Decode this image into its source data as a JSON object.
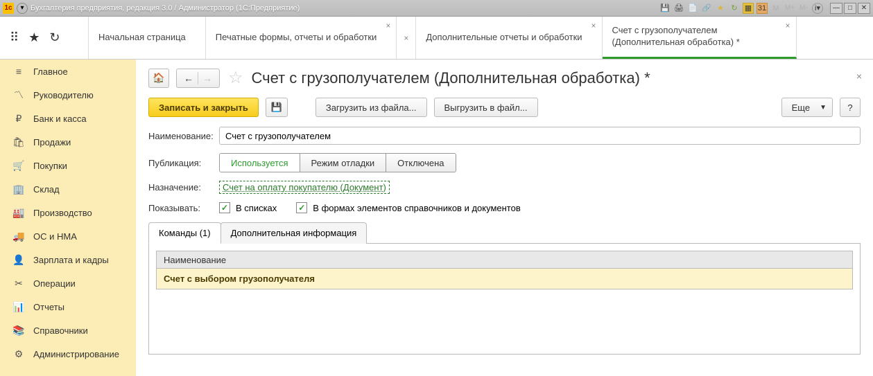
{
  "titlebar": {
    "left": "Бухгалтерия предприятия, редакция 3.0 / Администратор  (1С:Предприятие)"
  },
  "tool_letters": {
    "m1": "M",
    "m2": "M+",
    "m3": "M-"
  },
  "tabs": [
    {
      "label": "Начальная страница"
    },
    {
      "label": "Печатные формы, отчеты и обработки"
    },
    {
      "label": "Дополнительные отчеты и обработки"
    },
    {
      "label": "Счет с грузополучателем (Дополнительная обработка) *"
    }
  ],
  "sidebar": [
    {
      "icon": "≡",
      "label": "Главное"
    },
    {
      "icon": "〽",
      "label": "Руководителю"
    },
    {
      "icon": "₽",
      "label": "Банк и касса"
    },
    {
      "icon": "🛍",
      "label": "Продажи"
    },
    {
      "icon": "🛒",
      "label": "Покупки"
    },
    {
      "icon": "🏢",
      "label": "Склад"
    },
    {
      "icon": "🏭",
      "label": "Производство"
    },
    {
      "icon": "🚚",
      "label": "ОС и НМА"
    },
    {
      "icon": "👤",
      "label": "Зарплата и кадры"
    },
    {
      "icon": "✂",
      "label": "Операции"
    },
    {
      "icon": "📊",
      "label": "Отчеты"
    },
    {
      "icon": "📚",
      "label": "Справочники"
    },
    {
      "icon": "⚙",
      "label": "Администрирование"
    }
  ],
  "page": {
    "title": "Счет с грузополучателем (Дополнительная обработка) *"
  },
  "toolbar": {
    "save_close": "Записать и закрыть",
    "load_file": "Загрузить из файла...",
    "export_file": "Выгрузить в файл...",
    "more": "Еще",
    "help": "?"
  },
  "form": {
    "name_label": "Наименование:",
    "name_value": "Счет с грузополучателем",
    "publication_label": "Публикация:",
    "seg": {
      "used": "Используется",
      "debug": "Режим отладки",
      "disabled": "Отключена"
    },
    "purpose_label": "Назначение:",
    "purpose_link": "Счет на оплату покупателю (Документ)",
    "show_label": "Показывать:",
    "chk_lists": "В списках",
    "chk_forms": "В формах элементов справочников и документов"
  },
  "inner_tabs": {
    "commands": "Команды (1)",
    "extra": "Дополнительная информация"
  },
  "grid": {
    "header": "Наименование",
    "row0": "Счет с выбором грузополучателя"
  }
}
